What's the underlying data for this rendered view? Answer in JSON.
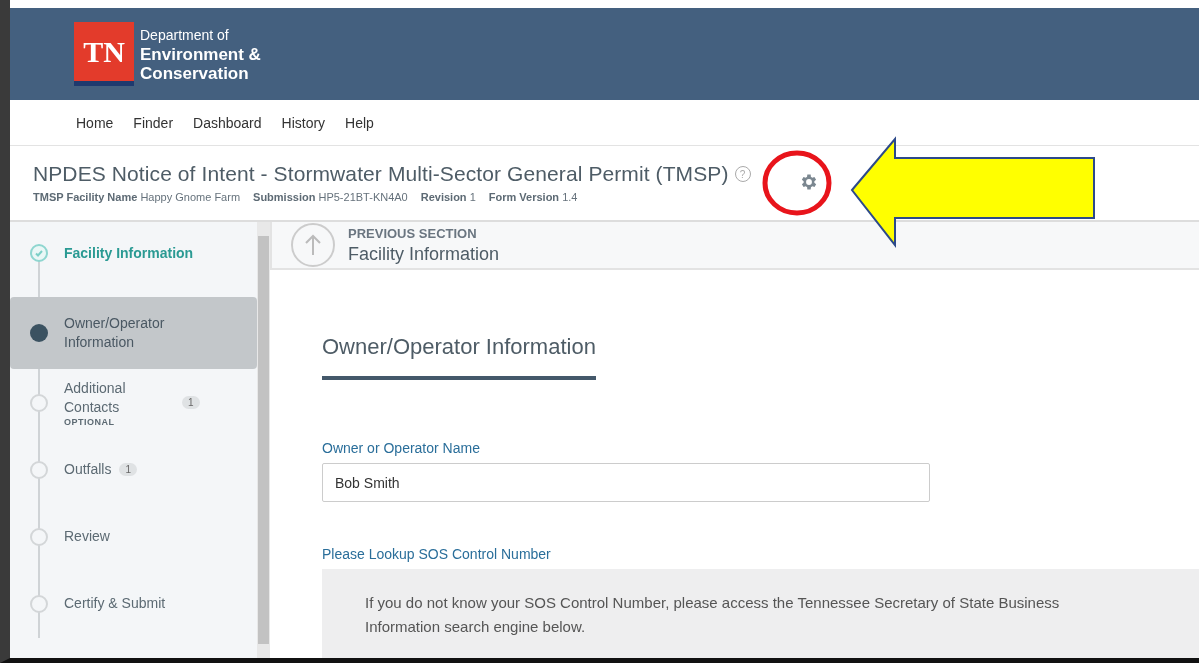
{
  "header": {
    "logo": "TN",
    "agency_line_1": "Department of",
    "agency_line_2": "Environment &",
    "agency_line_3": "Conservation"
  },
  "nav": [
    "Home",
    "Finder",
    "Dashboard",
    "History",
    "Help"
  ],
  "form_header": {
    "title": "NPDES Notice of Intent - Stormwater Multi-Sector General Permit (TMSP)",
    "help": "?",
    "meta": [
      {
        "label": "TMSP Facility Name",
        "value": "Happy Gnome Farm"
      },
      {
        "label": "Submission",
        "value": "HP5-21BT-KN4A0"
      },
      {
        "label": "Revision",
        "value": "1"
      },
      {
        "label": "Form Version",
        "value": "1.4"
      }
    ]
  },
  "steps": [
    {
      "label": "Facility Information",
      "kind": "complete",
      "selected": false
    },
    {
      "label": "Owner/Operator Information",
      "kind": "current",
      "selected": true
    },
    {
      "label": "Additional Contacts",
      "kind": "pending",
      "selected": false,
      "badge": "1",
      "note": "OPTIONAL"
    },
    {
      "label": "Outfalls",
      "kind": "pending",
      "selected": false,
      "badge": "1"
    },
    {
      "label": "Review",
      "kind": "pending",
      "selected": false
    },
    {
      "label": "Certify & Submit",
      "kind": "pending",
      "selected": false
    }
  ],
  "previous_section": {
    "caption": "PREVIOUS SECTION",
    "title": "Facility Information"
  },
  "section_title": "Owner/Operator Information",
  "fields": [
    {
      "label": "Owner or Operator Name",
      "value": "Bob Smith"
    }
  ],
  "lookup": {
    "label": "Please Lookup SOS Control Number",
    "text": "If you do not know your SOS Control Number, please access the Tennessee Secretary of State Business Information search engine below."
  }
}
